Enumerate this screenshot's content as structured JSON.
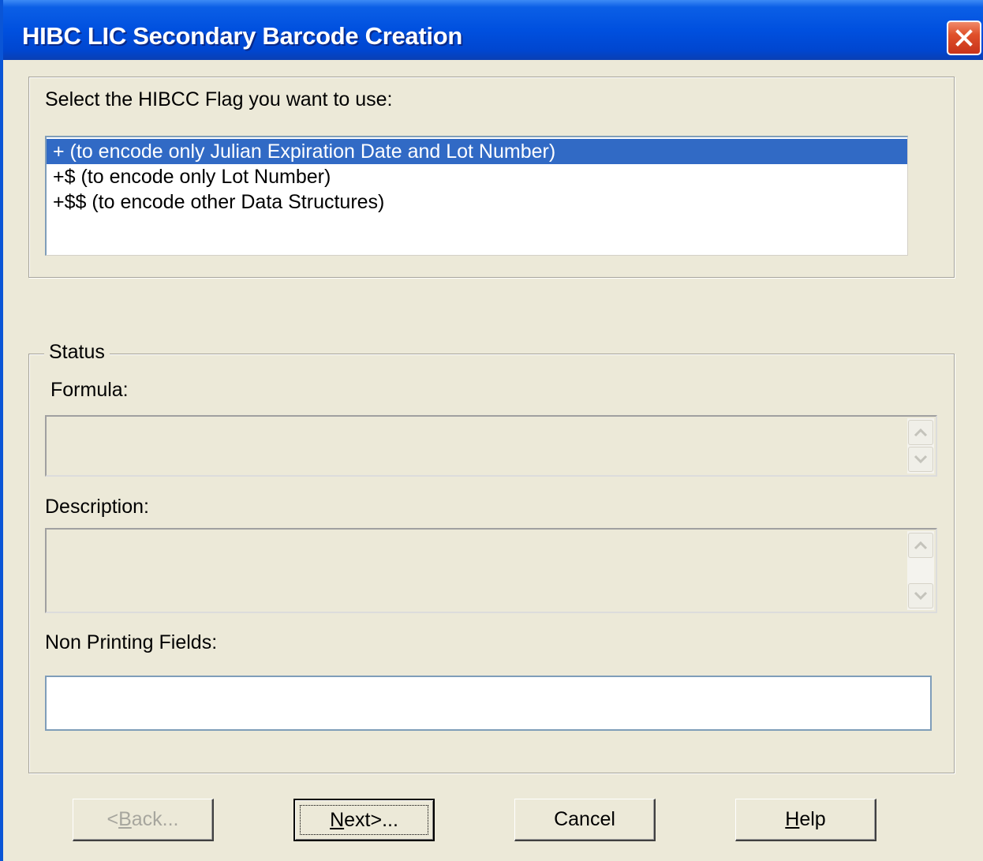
{
  "window": {
    "title": "HIBC LIC Secondary Barcode Creation"
  },
  "flag_section": {
    "prompt": "Select the HIBCC Flag you want to use:",
    "options": [
      "+ (to encode only Julian Expiration Date and Lot Number)",
      "+$ (to encode only Lot Number)",
      "+$$ (to encode other Data Structures)"
    ],
    "selected_index": 0
  },
  "status": {
    "legend": "Status",
    "formula_label": "Formula:",
    "formula_value": "",
    "description_label": "Description:",
    "description_value": "",
    "nonprinting_label": "Non Printing Fields:",
    "nonprinting_value": ""
  },
  "buttons": {
    "back": {
      "pre": "<",
      "mn": "B",
      "post": "ack..."
    },
    "next": {
      "pre": "",
      "mn": "N",
      "post": "ext>..."
    },
    "cancel": "Cancel",
    "help": {
      "pre": "",
      "mn": "H",
      "post": "elp"
    }
  },
  "colors": {
    "titlebar": "#0050df",
    "dialog_bg": "#ece9d8",
    "selection": "#316ac5",
    "close_button": "#e0502a"
  },
  "icons": {
    "close": "close-icon",
    "scroll_up": "chevron-up-icon",
    "scroll_down": "chevron-down-icon"
  }
}
